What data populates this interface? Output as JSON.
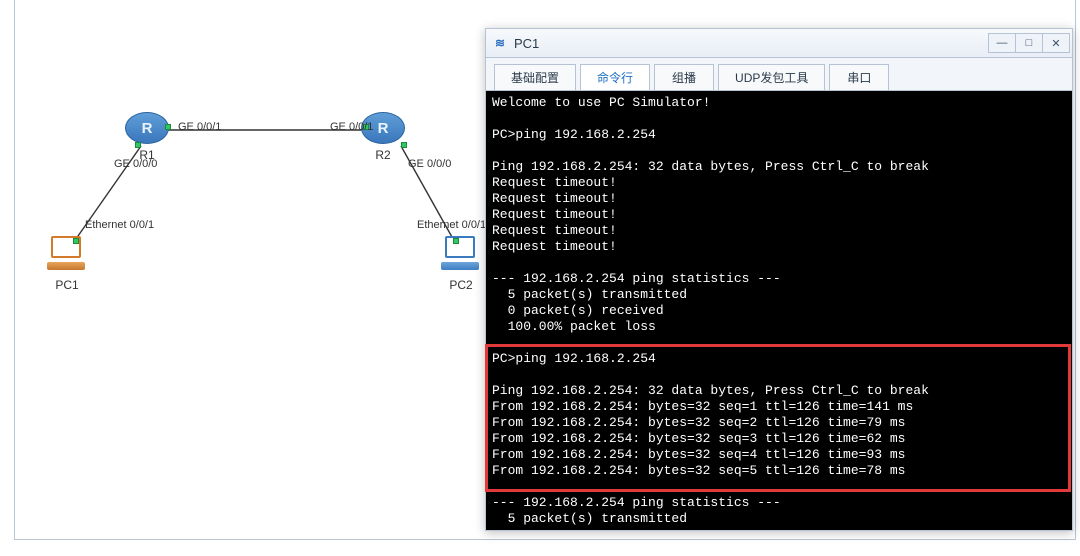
{
  "terminal": {
    "title": "PC1",
    "tabs": [
      {
        "label": "基础配置",
        "active": false
      },
      {
        "label": "命令行",
        "active": true
      },
      {
        "label": "组播",
        "active": false
      },
      {
        "label": "UDP发包工具",
        "active": false
      },
      {
        "label": "串口",
        "active": false
      }
    ],
    "lines": [
      "Welcome to use PC Simulator!",
      "",
      "PC>ping 192.168.2.254",
      "",
      "Ping 192.168.2.254: 32 data bytes, Press Ctrl_C to break",
      "Request timeout!",
      "Request timeout!",
      "Request timeout!",
      "Request timeout!",
      "Request timeout!",
      "",
      "--- 192.168.2.254 ping statistics ---",
      "  5 packet(s) transmitted",
      "  0 packet(s) received",
      "  100.00% packet loss",
      "",
      "PC>ping 192.168.2.254",
      "",
      "Ping 192.168.2.254: 32 data bytes, Press Ctrl_C to break",
      "From 192.168.2.254: bytes=32 seq=1 ttl=126 time=141 ms",
      "From 192.168.2.254: bytes=32 seq=2 ttl=126 time=79 ms",
      "From 192.168.2.254: bytes=32 seq=3 ttl=126 time=62 ms",
      "From 192.168.2.254: bytes=32 seq=4 ttl=126 time=93 ms",
      "From 192.168.2.254: bytes=32 seq=5 ttl=126 time=78 ms",
      "",
      "--- 192.168.2.254 ping statistics ---",
      "  5 packet(s) transmitted"
    ]
  },
  "topology": {
    "devices": {
      "r1": {
        "label": "R1",
        "glyph": "R"
      },
      "r2": {
        "label": "R2",
        "glyph": "R"
      },
      "pc1": {
        "label": "PC1"
      },
      "pc2": {
        "label": "PC2"
      }
    },
    "interfaces": {
      "r1_ge001": "GE 0/0/1",
      "r1_ge000": "GE 0/0/0",
      "r2_ge001": "GE 0/0/1",
      "r2_ge000": "GE 0/0/0",
      "pc1_eth": "Ethernet 0/0/1",
      "pc2_eth": "Ethernet 0/0/1"
    }
  },
  "window_controls": {
    "minimize": "—",
    "maximize": "□",
    "close": "✕"
  }
}
